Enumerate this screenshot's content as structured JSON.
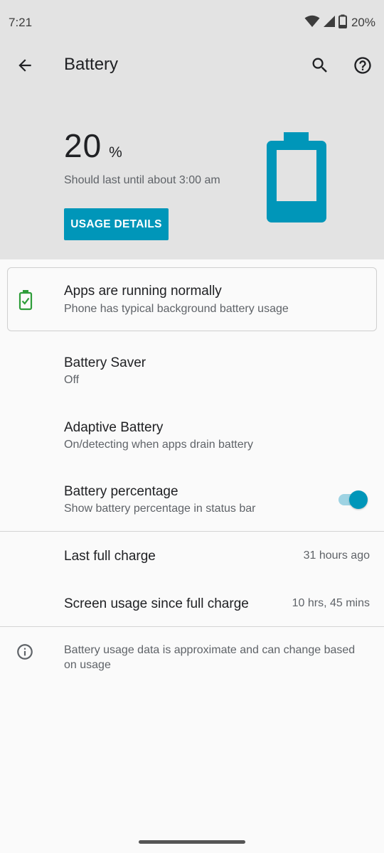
{
  "status_bar": {
    "time": "7:21",
    "battery_percent": "20%",
    "icons": [
      "wifi-icon",
      "cell-signal-icon",
      "battery-icon"
    ]
  },
  "app_bar": {
    "title": "Battery",
    "icons": [
      "arrow-back-icon",
      "search-icon",
      "help-icon"
    ]
  },
  "summary": {
    "level_value": "20",
    "level_unit": "%",
    "level_fraction": 0.2,
    "estimate": "Should last until about 3:00 am",
    "usage_details_label": "USAGE DETAILS"
  },
  "tip": {
    "icon": "battery-ok-icon",
    "title": "Apps are running normally",
    "subtitle": "Phone has typical background battery usage"
  },
  "preferences": [
    {
      "title": "Battery Saver",
      "summary": "Off"
    },
    {
      "title": "Adaptive Battery",
      "summary": "On/detecting when apps drain battery"
    },
    {
      "title": "Battery percentage",
      "summary": "Show battery percentage in status bar",
      "toggle_on": true
    }
  ],
  "info": [
    {
      "label": "Last full charge",
      "value": "31 hours ago"
    },
    {
      "label": "Screen usage since full charge",
      "value": "10 hrs, 45 mins"
    }
  ],
  "footer": {
    "icon": "info-icon",
    "text": "Battery usage data is approximate and can change based on usage"
  },
  "colors": {
    "accent": "#0096b9",
    "header_bg": "#e3e3e3",
    "page_bg": "#fafafa",
    "tip_icon": "#2e9d3a"
  }
}
